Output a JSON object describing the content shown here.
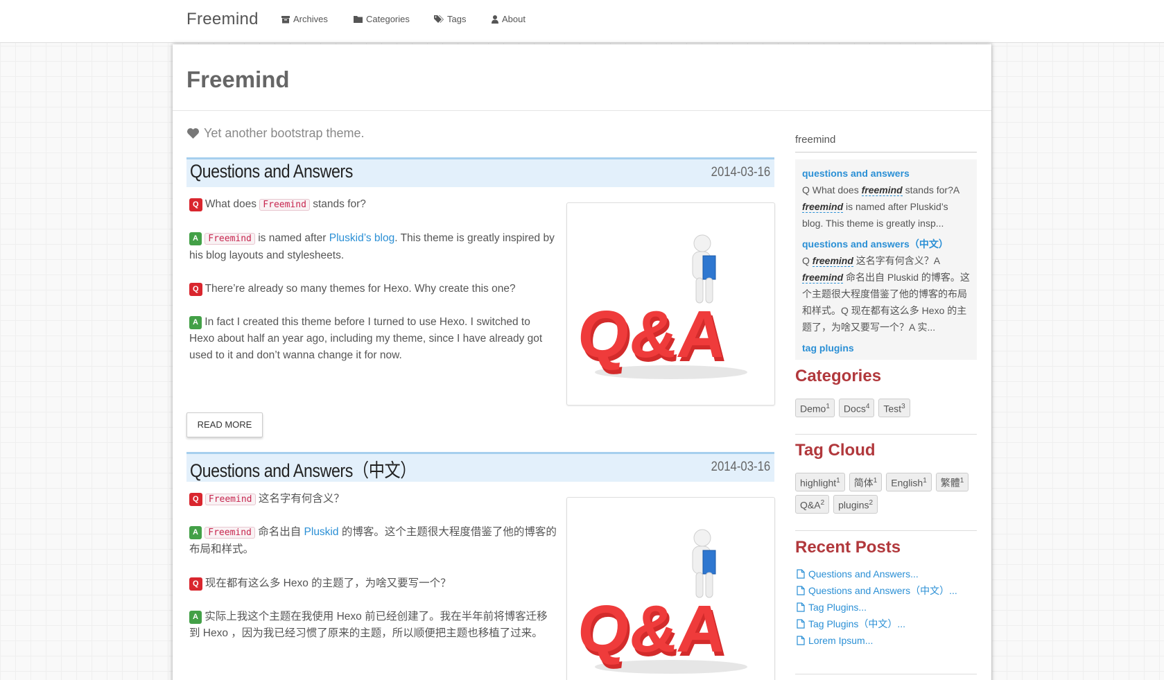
{
  "navbar": {
    "brand": "Freemind",
    "items": [
      {
        "label": "Archives",
        "icon": "archive-icon"
      },
      {
        "label": "Categories",
        "icon": "folder-icon"
      },
      {
        "label": "Tags",
        "icon": "tags-icon"
      },
      {
        "label": "About",
        "icon": "user-icon"
      }
    ]
  },
  "header": {
    "title": "Freemind",
    "tagline": "Yet another bootstrap theme.",
    "tagline_icon": "heart-icon"
  },
  "posts": [
    {
      "title": "Questions and Answers",
      "date": "2014-03-16",
      "q1_code": "Freemind",
      "q1_text": "What does",
      "q1_tail": "stands for?",
      "a1_code": "Freemind",
      "a1_text": "is named after",
      "a1_link": "Pluskid’s blog",
      "a1_tail": ". This theme is greatly inspired by his blog layouts and stylesheets.",
      "q2_text": "There’re already so many themes for Hexo. Why create this one?",
      "a2_text": "In fact I created this theme before I turned to use Hexo. I switched to Hexo about half an year ago, including my theme, since I have already got used to it and don’t wanna change it for now.",
      "read_more": "READ MORE"
    },
    {
      "title": "Questions and Answers（中文）",
      "date": "2014-03-16",
      "q1_code": "Freemind",
      "q1_tail": "这名字有何含义？",
      "a1_code": "Freemind",
      "a1_text": "命名出自",
      "a1_link": "Pluskid",
      "a1_tail": "的博客。这个主题很大程度借鉴了他的博客的布局和样式。",
      "q2_text": "现在都有这么多 Hexo 的主题了，为啥又要写一个？",
      "a2_text": "实际上我这个主题在我使用 Hexo 前已经创建了。我在半年前将博客迁移到 Hexo ，因为我已经习惯了原来的主题，所以顺便把主题也移植了过来。"
    }
  ],
  "badges": {
    "q": "Q",
    "a": "A"
  },
  "sidebar": {
    "search_value": "freemind",
    "search_results": [
      {
        "title": "questions and answers",
        "pre": "Q What does ",
        "em1": "freemind",
        "mid": " stands for?A ",
        "em2": "freemind",
        "post": " is named after Pluskid’s blog. This theme is greatly insp..."
      },
      {
        "title": "questions and answers（中文）",
        "pre": "Q ",
        "em1": "freemind",
        "mid": " 这名字有何含义？A ",
        "em2": "freemind",
        "post": " 命名出自 Pluskid 的博客。这个主题很大程度借鉴了他的博客的布局和样式。Q 现在都有这么多 Hexo 的主题了，为啥又要写一个？A 实..."
      },
      {
        "title": "tag plugins"
      }
    ],
    "categories_heading": "Categories",
    "categories": [
      {
        "label": "Demo",
        "count": "1"
      },
      {
        "label": "Docs",
        "count": "4"
      },
      {
        "label": "Test",
        "count": "3"
      }
    ],
    "tagcloud_heading": "Tag Cloud",
    "tags_row1": [
      {
        "label": "highlight",
        "count": "1"
      },
      {
        "label": "简体",
        "count": "1"
      },
      {
        "label": "English",
        "count": "1"
      },
      {
        "label": "繁體",
        "count": "1"
      }
    ],
    "tags_row2": [
      {
        "label": "Q&A",
        "count": "2"
      },
      {
        "label": "plugins",
        "count": "2"
      }
    ],
    "recent_heading": "Recent Posts",
    "recent_posts": [
      "Questions and Answers...",
      "Questions and Answers（中文）...",
      "Tag Plugins...",
      "Tag Plugins（中文）...",
      "Lorem Ipsum..."
    ]
  },
  "colors": {
    "accent_link": "#2a8fd5",
    "heading_red": "#b1383c",
    "post_header_bg": "#e3f0fb",
    "badge_q": "#d9262e",
    "badge_a": "#43a047"
  },
  "illustration": {
    "icon": "qa-figure-icon",
    "text": "Q&A"
  }
}
